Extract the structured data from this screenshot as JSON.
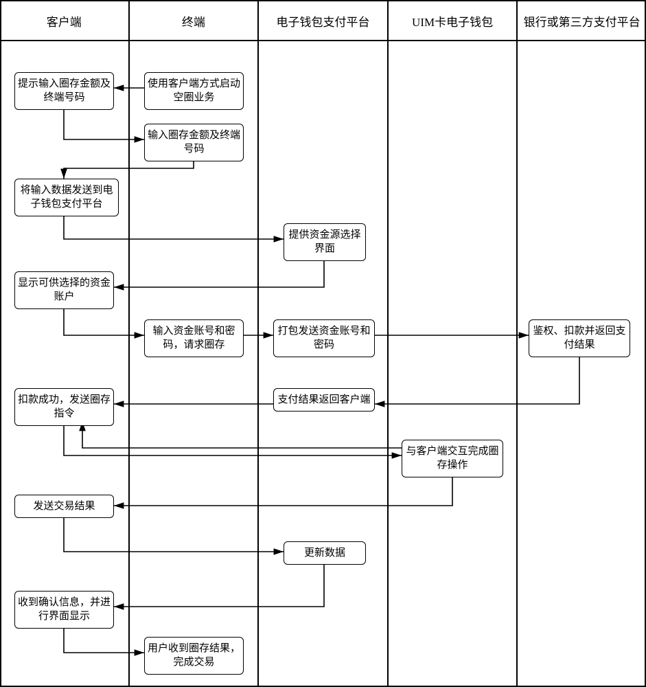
{
  "lanes": {
    "col1": "客户端",
    "col2": "终端",
    "col3": "电子钱包支付平台",
    "col4": "UIM卡电子钱包",
    "col5": "银行或第三方支付平台"
  },
  "nodes": {
    "n1": "使用客户端方式启动空圈业务",
    "n2": "提示输入圈存金额及终端号码",
    "n3": "输入圈存金额及终端号码",
    "n4": "将输入数据发送到电子钱包支付平台",
    "n5": "提供资金源选择界面",
    "n6": "显示可供选择的资金账户",
    "n7": "输入资金账号和密码，请求圈存",
    "n8": "打包发送资金账号和密码",
    "n9": "鉴权、扣款并返回支付结果",
    "n10": "支付结果返回客户端",
    "n11": "扣款成功，发送圈存指令",
    "n12": "与客户端交互完成圈存操作",
    "n13": "发送交易结果",
    "n14": "更新数据",
    "n15": "收到确认信息，并进行界面显示",
    "n16": "用户收到圈存结果，完成交易"
  },
  "chart_data": {
    "type": "swimlane-flowchart",
    "lanes": [
      "客户端",
      "终端",
      "电子钱包支付平台",
      "UIM卡电子钱包",
      "银行或第三方支付平台"
    ],
    "steps": [
      {
        "id": "n1",
        "lane": "终端",
        "text": "使用客户端方式启动空圈业务"
      },
      {
        "id": "n2",
        "lane": "客户端",
        "text": "提示输入圈存金额及终端号码"
      },
      {
        "id": "n3",
        "lane": "终端",
        "text": "输入圈存金额及终端号码"
      },
      {
        "id": "n4",
        "lane": "客户端",
        "text": "将输入数据发送到电子钱包支付平台"
      },
      {
        "id": "n5",
        "lane": "电子钱包支付平台",
        "text": "提供资金源选择界面"
      },
      {
        "id": "n6",
        "lane": "客户端",
        "text": "显示可供选择的资金账户"
      },
      {
        "id": "n7",
        "lane": "终端",
        "text": "输入资金账号和密码，请求圈存"
      },
      {
        "id": "n8",
        "lane": "电子钱包支付平台",
        "text": "打包发送资金账号和密码"
      },
      {
        "id": "n9",
        "lane": "银行或第三方支付平台",
        "text": "鉴权、扣款并返回支付结果"
      },
      {
        "id": "n10",
        "lane": "电子钱包支付平台",
        "text": "支付结果返回客户端"
      },
      {
        "id": "n11",
        "lane": "客户端",
        "text": "扣款成功，发送圈存指令"
      },
      {
        "id": "n12",
        "lane": "UIM卡电子钱包",
        "text": "与客户端交互完成圈存操作"
      },
      {
        "id": "n13",
        "lane": "客户端",
        "text": "发送交易结果"
      },
      {
        "id": "n14",
        "lane": "电子钱包支付平台",
        "text": "更新数据"
      },
      {
        "id": "n15",
        "lane": "客户端",
        "text": "收到确认信息，并进行界面显示"
      },
      {
        "id": "n16",
        "lane": "终端",
        "text": "用户收到圈存结果，完成交易"
      }
    ],
    "edges": [
      [
        "n1",
        "n2"
      ],
      [
        "n2",
        "n3"
      ],
      [
        "n3",
        "n4"
      ],
      [
        "n4",
        "n5"
      ],
      [
        "n5",
        "n6"
      ],
      [
        "n6",
        "n7"
      ],
      [
        "n7",
        "n8"
      ],
      [
        "n8",
        "n9"
      ],
      [
        "n9",
        "n10"
      ],
      [
        "n10",
        "n11"
      ],
      [
        "n11",
        "n12"
      ],
      [
        "n12",
        "n11"
      ],
      [
        "n12",
        "n13"
      ],
      [
        "n13",
        "n14"
      ],
      [
        "n14",
        "n15"
      ],
      [
        "n15",
        "n16"
      ]
    ]
  }
}
